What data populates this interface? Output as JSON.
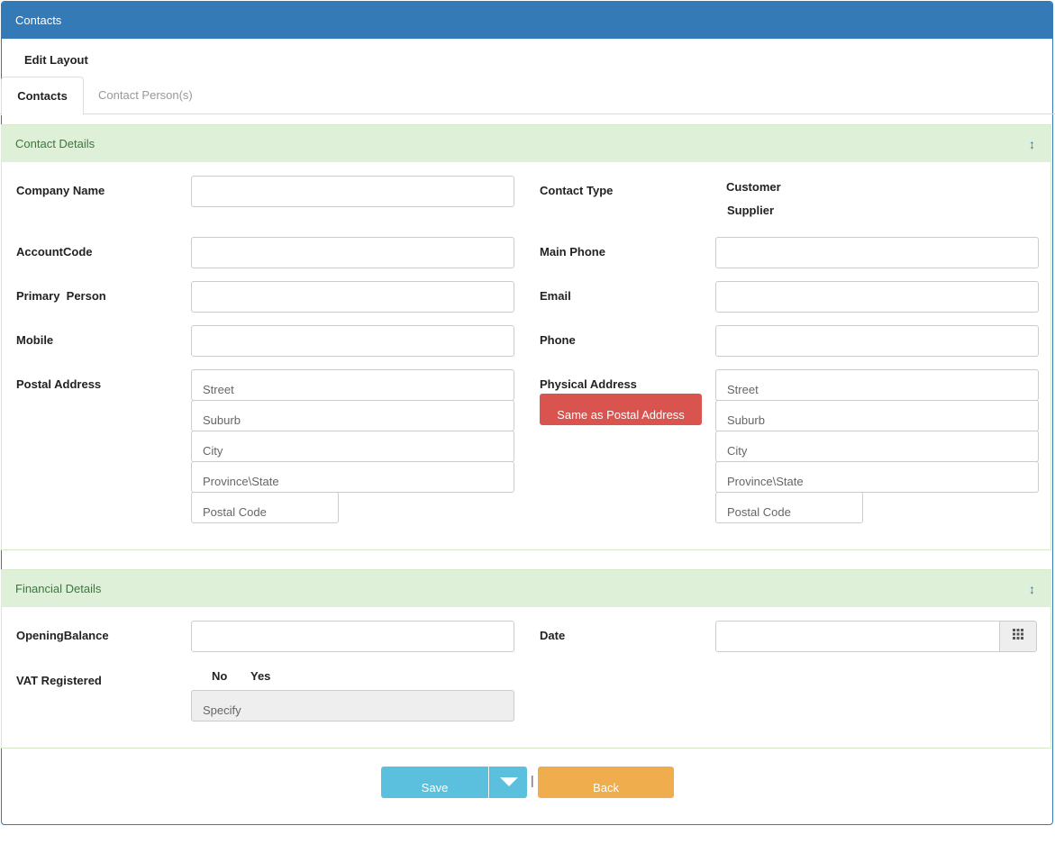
{
  "header": {
    "title": "Contacts"
  },
  "edit_layout": "Edit Layout",
  "tabs": [
    {
      "label": "Contacts"
    },
    {
      "label": "Contact Person(s)"
    }
  ],
  "contact_details": {
    "title": "Contact Details",
    "toggle_icon": "↕",
    "company_name_label": "Company Name",
    "contact_type_label": "Contact Type",
    "contact_type_options": [
      "Customer",
      "Supplier"
    ],
    "account_code_label": "AccountCode",
    "main_phone_label": "Main Phone",
    "primary_person_label": "Primary  Person",
    "email_label": "Email",
    "mobile_label": "Mobile",
    "phone_label": "Phone",
    "postal_address_label": "Postal Address",
    "physical_address_label": "Physical Address",
    "same_as_postal_button": "Same as Postal Address",
    "address_placeholders": {
      "street": "Street",
      "suburb": "Suburb",
      "city": "City",
      "province": "Province\\State",
      "postal_code": "Postal Code"
    }
  },
  "financial_details": {
    "title": "Financial Details",
    "toggle_icon": "↕",
    "opening_balance_label": "OpeningBalance",
    "date_label": "Date",
    "calendar_icon": "calendar-icon",
    "vat_label": "VAT Registered",
    "vat_options": [
      "No",
      "Yes"
    ],
    "specify_placeholder": "Specify"
  },
  "actions": {
    "save_label": "Save",
    "separator": "|",
    "back_label": "Back"
  },
  "colors": {
    "primary": "#337ab7",
    "section_bg": "#dff0d8",
    "section_text": "#3c763d",
    "danger": "#d9534f",
    "info": "#5bc0de",
    "warning": "#f0ad4e"
  }
}
